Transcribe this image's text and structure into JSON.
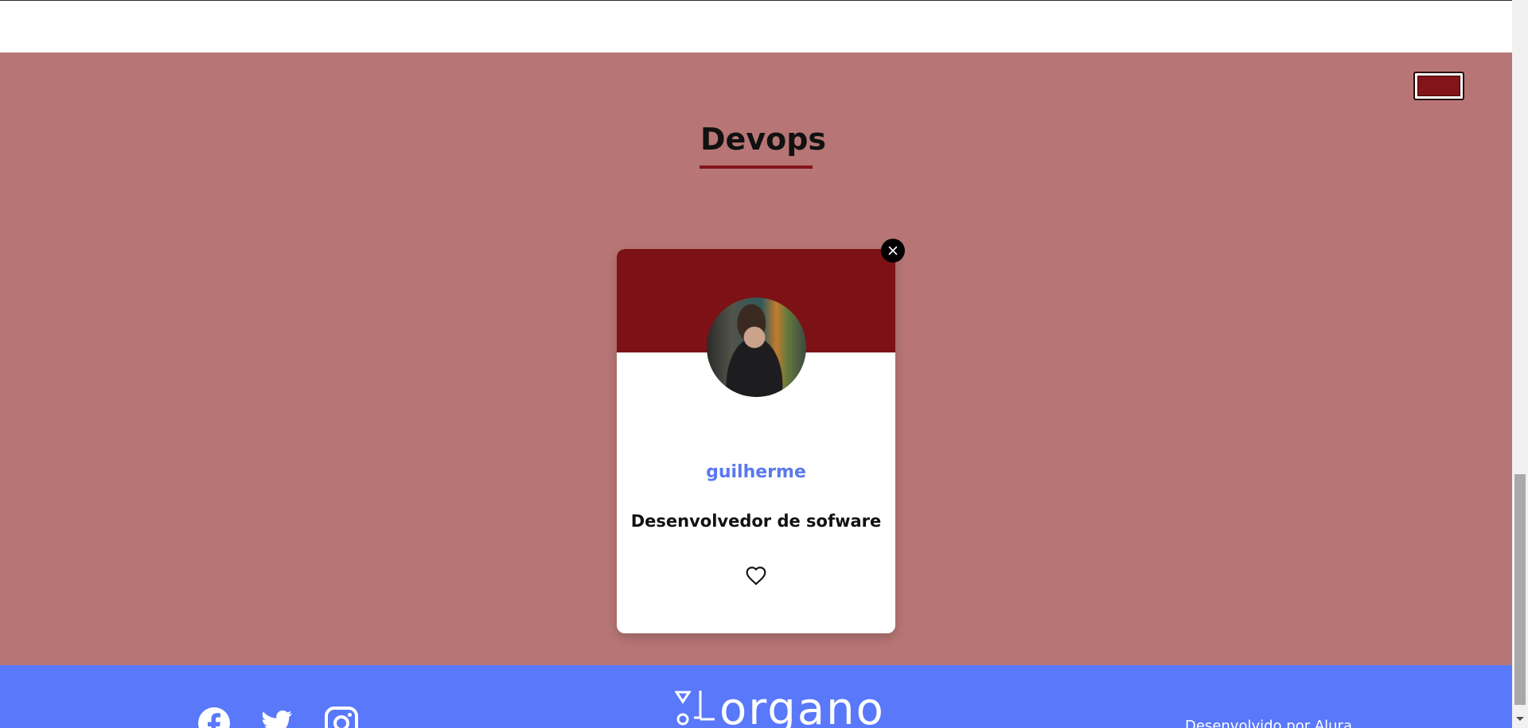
{
  "team": {
    "title": "Devops",
    "color": "#82141a",
    "background_color": "#b77675"
  },
  "color_picker": {
    "value": "#82141a"
  },
  "member": {
    "name": "guilherme",
    "role": "Desenvolvedor de sofware",
    "header_color": "#7c1215",
    "favorite": false
  },
  "icons": {
    "delete": "close-icon",
    "favorite": "heart-outline-icon",
    "facebook": "facebook-icon",
    "twitter": "twitter-icon",
    "instagram": "instagram-icon"
  },
  "footer": {
    "logo_text": "organo",
    "credit": "Desenvolvido por Alura.",
    "background_color": "#5978fa"
  }
}
